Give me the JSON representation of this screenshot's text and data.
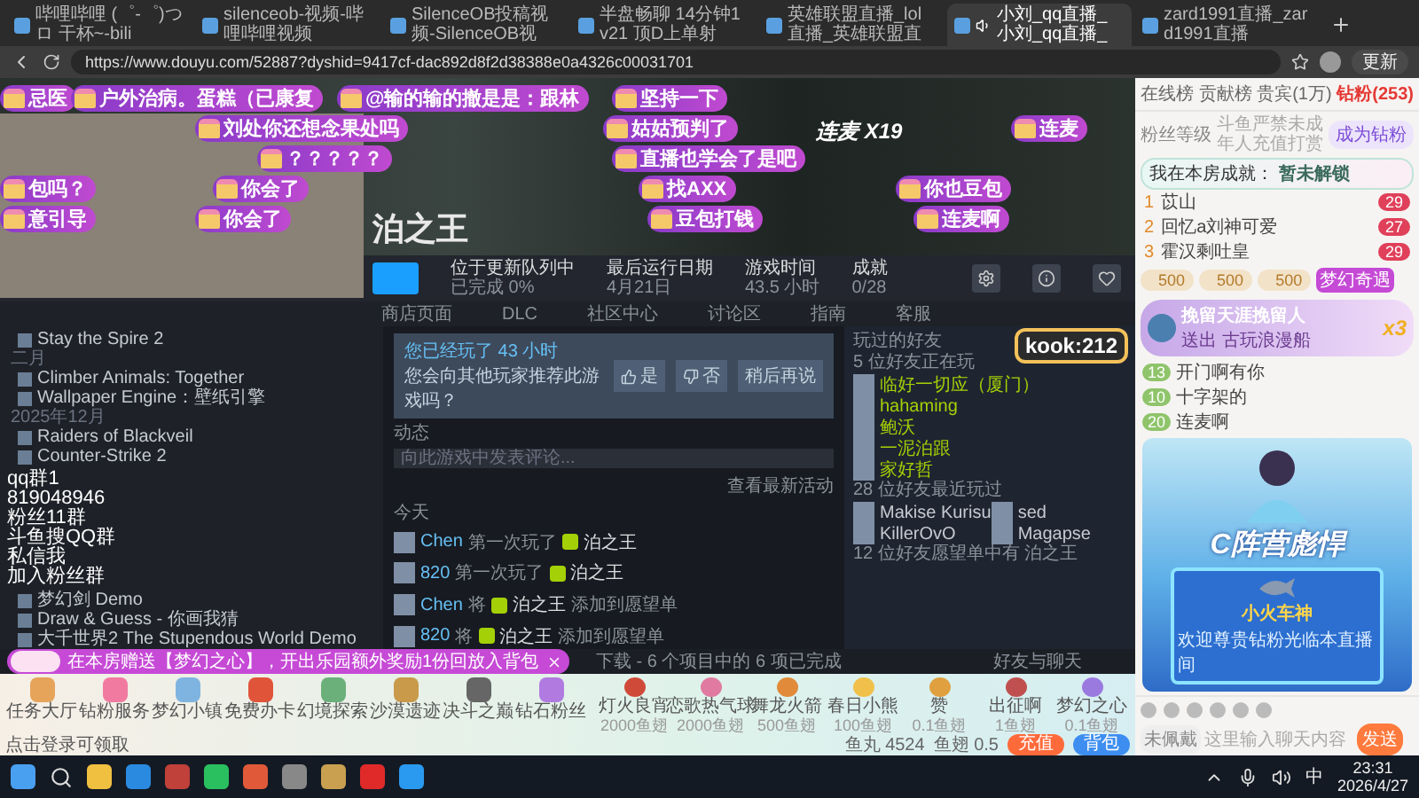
{
  "browser": {
    "tabs": [
      {
        "title": "哔哩哔哩 (゜-゜)つロ 干杯~-bili",
        "selected": false,
        "audio": false
      },
      {
        "title": "silenceob-视频-哔哩哔哩视频",
        "selected": false,
        "audio": false
      },
      {
        "title": "SilenceOB投稿视频-SilenceOB视",
        "selected": false,
        "audio": false
      },
      {
        "title": "半盘畅聊 14分钟1v21 顶D上单射",
        "selected": false,
        "audio": false
      },
      {
        "title": "英雄联盟直播_lol直播_英雄联盟直",
        "selected": false,
        "audio": false
      },
      {
        "title": "小刘_qq直播_小刘_qq直播_",
        "selected": true,
        "audio": true
      },
      {
        "title": "zard1991直播_zard1991直播",
        "selected": false,
        "audio": false
      }
    ],
    "url": "https://www.douyu.com/52887?dyshid=9417cf-dac892d8f2d38388e0a4326c00031701",
    "update_button": "更新"
  },
  "video": {
    "hero_title": "泊之王",
    "stats": [
      {
        "label": "位于更新队列中",
        "value": "已完成 0%"
      },
      {
        "label": "最后运行日期",
        "value": "4月21日"
      },
      {
        "label": "游戏时间",
        "value": "43.5 小时"
      },
      {
        "label": "成就",
        "value": "0/28"
      }
    ],
    "steam_tabs": [
      "商店页面",
      "DLC",
      "社区中心",
      "讨论区",
      "指南",
      "客服"
    ],
    "game_list": [
      {
        "kind": "game",
        "label": "Stay the Spire 2"
      },
      {
        "kind": "header",
        "label": "二月"
      },
      {
        "kind": "game",
        "label": "Climber Animals: Together"
      },
      {
        "kind": "game",
        "label": "Wallpaper Engine：壁纸引擎"
      },
      {
        "kind": "header",
        "label": "2025年12月"
      },
      {
        "kind": "game",
        "label": "Raiders of Blackveil"
      },
      {
        "kind": "game",
        "label": "Counter-Strike 2"
      }
    ],
    "game_list_more": [
      {
        "kind": "game",
        "label": "梦幻剑 Demo"
      },
      {
        "kind": "game",
        "label": "Draw & Guess - 你画我猜"
      },
      {
        "kind": "game",
        "label": "大千世界2 The Stupendous World Demo"
      }
    ],
    "stream_overlay": [
      "qq群1",
      "819048946",
      "粉丝11群",
      "斗鱼搜QQ群",
      "私信我",
      "加入粉丝群"
    ],
    "review": {
      "title": "您已经玩了 43 小时",
      "question": "您会向其他玩家推荐此游戏吗？",
      "buttons": [
        "是",
        "否",
        "稍后再说"
      ]
    },
    "activity": {
      "title": "动态",
      "placeholder": "向此游戏中发表评论...",
      "link": "查看最新活动",
      "day": "今天",
      "items": [
        {
          "user": "Chen",
          "action": "第一次玩了",
          "game": "泊之王"
        },
        {
          "user": "820",
          "action": "第一次玩了",
          "game": "泊之王"
        },
        {
          "user": "Chen",
          "action": "将",
          "game": "泊之王",
          "tail": "添加到愿望单"
        },
        {
          "user": "820",
          "action": "将",
          "game": "泊之王",
          "tail": "添加到愿望单"
        }
      ]
    },
    "friends": {
      "title": "玩过的好友",
      "playing_label": "5 位好友正在玩",
      "playing": [
        "临好一切应（厦门）",
        "hahaming",
        "鲍沃",
        "一泥泊跟",
        "家好哲"
      ],
      "recent_label": "28 位好友最近玩过",
      "recent": [
        "Makise Kurisu",
        "sed",
        "KillerOvO",
        "Magapse"
      ],
      "wishlist": "12 位好友愿望单中有 泊之王"
    },
    "logo_text": "kook:212",
    "downloads": "下载 - 6 个项目中的 6 项已完成",
    "friends_chat": "好友与聊天",
    "danmaku": [
      "忌医",
      "户外治病。蛋糕（已康复",
      "@输的输的撤是是：跟林",
      "坚持一下",
      "刘处你还想念果处吗",
      "姑姑预判了",
      "连麦",
      "？？？？？",
      "直播也学会了是吧",
      "包吗？",
      "你会了",
      "找AXX",
      "你也豆包",
      "意引导",
      "你会了",
      "豆包打钱",
      "连麦啊"
    ],
    "combo": "连麦 X19",
    "notice": "在本房赠送【梦幻之心】，开出乐园额外奖励1份回放入背包"
  },
  "gift_bar": {
    "activities": [
      "任务大厅",
      "钻粉服务",
      "梦幻小镇",
      "免费办卡",
      "幻境探索",
      "沙漠遗迹",
      "决斗之巅",
      "钻石粉丝"
    ],
    "gifts": [
      {
        "name": "灯火良宵",
        "price": "2000鱼翅"
      },
      {
        "name": "恋歌热气球",
        "price": "2000鱼翅"
      },
      {
        "name": "舞龙火箭",
        "price": "500鱼翅"
      },
      {
        "name": "春日小熊",
        "price": "100鱼翅"
      },
      {
        "name": "赞",
        "price": "0.1鱼翅"
      },
      {
        "name": "出征啊",
        "price": "1鱼翅"
      },
      {
        "name": "梦幻之心",
        "price": "0.1鱼翅"
      }
    ],
    "login_hint": "点击登录可领取",
    "balance": [
      {
        "label": "鱼丸",
        "value": "4524"
      },
      {
        "label": "鱼翅",
        "value": "0.5"
      }
    ],
    "recharge": "充值",
    "backpack": "背包"
  },
  "chat": {
    "tabs": [
      {
        "label": "在线榜",
        "selected": false
      },
      {
        "label": "贡献榜",
        "selected": false
      },
      {
        "label": "贵宾(1万)",
        "selected": false
      },
      {
        "label": "钻粉(253)",
        "selected": true
      }
    ],
    "fan_level": "粉丝等级",
    "notice": "斗鱼严禁未成年人充值打赏",
    "join_button": "成为钻粉",
    "achievement_label": "我在本房成就：",
    "achievement_value": "暂未解锁",
    "ranks": [
      {
        "rank": "1",
        "name": "苡山",
        "level": "29"
      },
      {
        "rank": "2",
        "name": "回忆a刘神可爱",
        "level": "27"
      },
      {
        "rank": "3",
        "name": "霍汉剩吐皇",
        "level": "29"
      }
    ],
    "chips": [
      "500",
      "500",
      "500"
    ],
    "event_badge": "梦幻奇遇",
    "announcement": {
      "title": "挽留天涯挽留人",
      "detail": "送出 古玩浪漫船",
      "count": "x3"
    },
    "messages": [
      {
        "level": "13",
        "text": "开门啊有你"
      },
      {
        "level": "10",
        "text": "十字架的"
      },
      {
        "level": "20",
        "text": "连麦啊"
      }
    ],
    "promo": {
      "title": "C阵营彪悍",
      "name": "小火车神",
      "welcome": "欢迎尊贵钻粉光临本直播间"
    },
    "medal": "未佩戴",
    "placeholder": "这里输入聊天内容",
    "send": "发送"
  },
  "taskbar": {
    "ime": "中",
    "time": "23:31",
    "date": "2026/4/27"
  }
}
